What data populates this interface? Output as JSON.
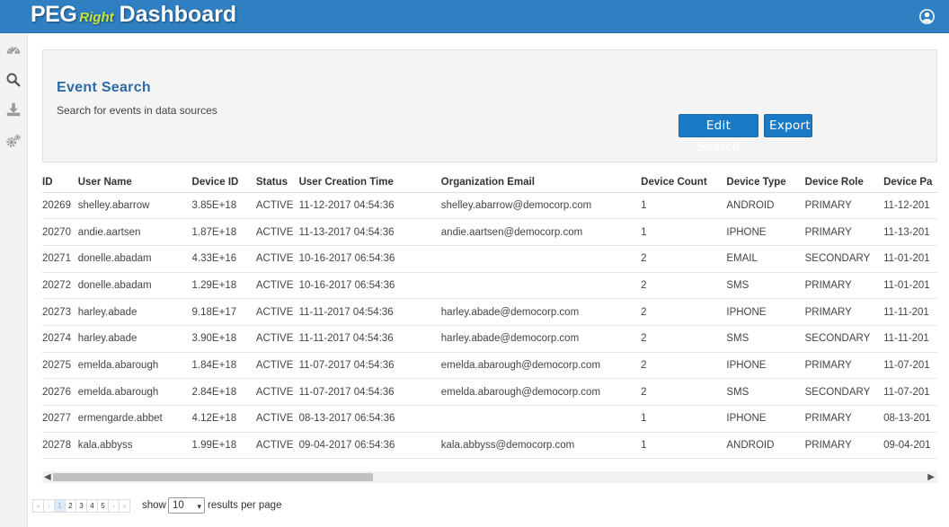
{
  "header": {
    "brand_main": "PEG",
    "brand_sub": "Right",
    "brand_title": "Dashboard",
    "user_icon": "user-circle-icon"
  },
  "sidebar": {
    "items": [
      {
        "icon": "dashboard-gauge-icon"
      },
      {
        "icon": "search-icon"
      },
      {
        "icon": "download-icon"
      },
      {
        "icon": "gears-icon"
      }
    ]
  },
  "panel": {
    "title": "Event Search",
    "subtitle": "Search for events in data sources",
    "edit_label": "Edit Search",
    "export_label": "Export"
  },
  "table": {
    "columns": [
      "ID",
      "User Name",
      "Device ID",
      "Status",
      "User Creation Time",
      "Organization Email",
      "Device Count",
      "Device Type",
      "Device Role",
      "Device Pa"
    ],
    "rows": [
      [
        "20269",
        "shelley.abarrow",
        "3.85E+18",
        "ACTIVE",
        "11-12-2017 04:54:36",
        "shelley.abarrow@democorp.com",
        "1",
        "ANDROID",
        "PRIMARY",
        "11-12-201"
      ],
      [
        "20270",
        "andie.aartsen",
        "1.87E+18",
        "ACTIVE",
        "11-13-2017 04:54:36",
        "andie.aartsen@democorp.com",
        "1",
        "IPHONE",
        "PRIMARY",
        "11-13-201"
      ],
      [
        "20271",
        "donelle.abadam",
        "4.33E+16",
        "ACTIVE",
        "10-16-2017 06:54:36",
        "",
        "2",
        "EMAIL",
        "SECONDARY",
        "11-01-201"
      ],
      [
        "20272",
        "donelle.abadam",
        "1.29E+18",
        "ACTIVE",
        "10-16-2017 06:54:36",
        "",
        "2",
        "SMS",
        "PRIMARY",
        "11-01-201"
      ],
      [
        "20273",
        "harley.abade",
        "9.18E+17",
        "ACTIVE",
        "11-11-2017 04:54:36",
        "harley.abade@democorp.com",
        "2",
        "IPHONE",
        "PRIMARY",
        "11-11-201"
      ],
      [
        "20274",
        "harley.abade",
        "3.90E+18",
        "ACTIVE",
        "11-11-2017 04:54:36",
        "harley.abade@democorp.com",
        "2",
        "SMS",
        "SECONDARY",
        "11-11-201"
      ],
      [
        "20275",
        "emelda.abarough",
        "1.84E+18",
        "ACTIVE",
        "11-07-2017 04:54:36",
        "emelda.abarough@democorp.com",
        "2",
        "IPHONE",
        "PRIMARY",
        "11-07-201"
      ],
      [
        "20276",
        "emelda.abarough",
        "2.84E+18",
        "ACTIVE",
        "11-07-2017 04:54:36",
        "emelda.abarough@democorp.com",
        "2",
        "SMS",
        "SECONDARY",
        "11-07-201"
      ],
      [
        "20277",
        "ermengarde.abbet",
        "4.12E+18",
        "ACTIVE",
        "08-13-2017 06:54:36",
        "",
        "1",
        "IPHONE",
        "PRIMARY",
        "08-13-201"
      ],
      [
        "20278",
        "kala.abbyss",
        "1.99E+18",
        "ACTIVE",
        "09-04-2017 06:54:36",
        "kala.abbyss@democorp.com",
        "1",
        "ANDROID",
        "PRIMARY",
        "09-04-201"
      ]
    ]
  },
  "pagination": {
    "first": "«",
    "prev": "‹",
    "pages": [
      "1",
      "2",
      "3",
      "4",
      "5"
    ],
    "current": "1",
    "next": "›",
    "last": "»",
    "show_label": "show",
    "per_page": "10",
    "results_label": "results per page"
  },
  "scrollbar": {
    "left_arrow": "◀",
    "right_arrow": "▶"
  },
  "colors": {
    "header_bg": "#2f7fc2",
    "brand_accent": "#c8e63d",
    "button_bg": "#1b7ac6",
    "title_color": "#2c6aa6"
  }
}
